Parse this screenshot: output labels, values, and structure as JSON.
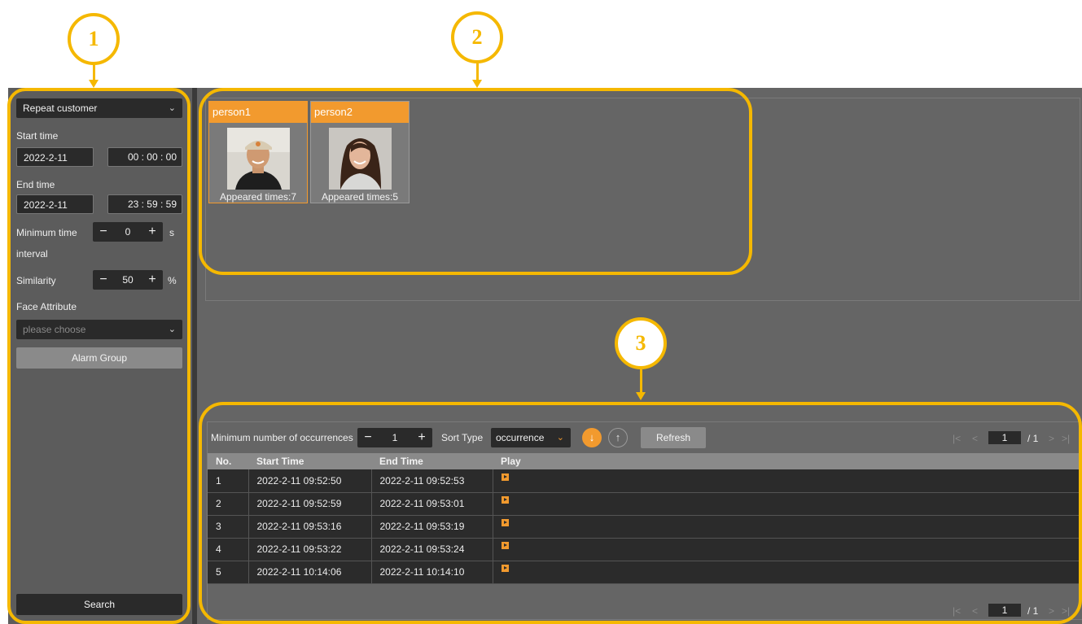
{
  "annotations": [
    "1",
    "2",
    "3"
  ],
  "sidebar": {
    "mode_select": "Repeat customer",
    "start_time_label": "Start time",
    "start_date": "2022-2-11",
    "start_clock": "00 : 00 : 00",
    "end_time_label": "End time",
    "end_date": "2022-2-11",
    "end_clock": "23 : 59 : 59",
    "min_interval_label_1": "Minimum time",
    "min_interval_label_2": "interval",
    "min_interval_value": "0",
    "min_interval_unit": "s",
    "similarity_label": "Similarity",
    "similarity_value": "50",
    "similarity_unit": "%",
    "face_attribute_label": "Face Attribute",
    "face_attribute_placeholder": "please choose",
    "alarm_group_button": "Alarm Group",
    "search_button": "Search",
    "stepper_minus": "−",
    "stepper_plus": "+"
  },
  "persons": [
    {
      "name": "person1",
      "appeared": "Appeared times:7",
      "selected": true
    },
    {
      "name": "person2",
      "appeared": "Appeared times:5",
      "selected": false
    }
  ],
  "results": {
    "min_occurrences_label": "Minimum number of occurrences",
    "min_occurrences_value": "1",
    "sort_type_label": "Sort Type",
    "sort_type_value": "occurrence",
    "sort_desc_icon": "↓",
    "sort_asc_icon": "↑",
    "refresh_button": "Refresh",
    "pager": {
      "first": "|<",
      "prev": "<",
      "page": "1",
      "total": "/ 1",
      "next": ">",
      "last": ">|"
    },
    "columns": [
      "No.",
      "Start Time",
      "End Time",
      "Play"
    ],
    "rows": [
      {
        "no": "1",
        "start": "2022-2-11 09:52:50",
        "end": "2022-2-11 09:52:53"
      },
      {
        "no": "2",
        "start": "2022-2-11 09:52:59",
        "end": "2022-2-11 09:53:01"
      },
      {
        "no": "3",
        "start": "2022-2-11 09:53:16",
        "end": "2022-2-11 09:53:19"
      },
      {
        "no": "4",
        "start": "2022-2-11 09:53:22",
        "end": "2022-2-11 09:53:24"
      },
      {
        "no": "5",
        "start": "2022-2-11 10:14:06",
        "end": "2022-2-11 10:14:10"
      }
    ]
  },
  "colors": {
    "accent": "#f29a2e",
    "annotation": "#f5b800",
    "panel": "#656565",
    "dark": "#2a2a2a"
  }
}
